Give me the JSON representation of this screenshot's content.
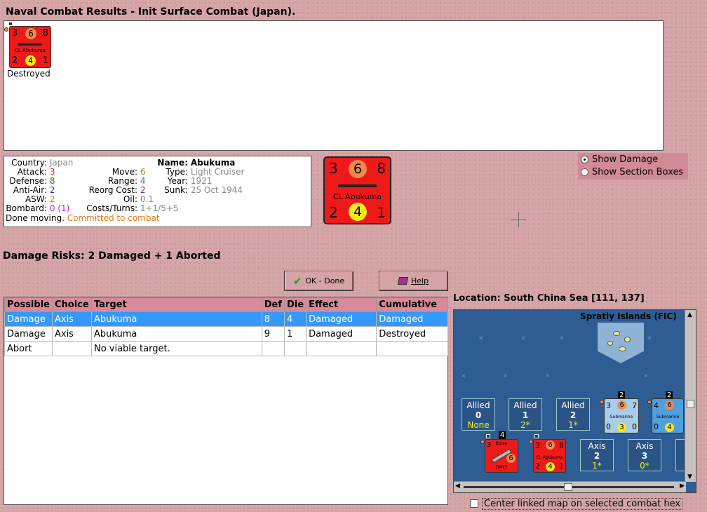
{
  "window": {
    "title": "Naval Combat Results - Init Surface Combat (Japan)."
  },
  "results": {
    "counter": {
      "top_left": "3",
      "top_center": "6",
      "top_right": "8",
      "name": "CL Abukuma",
      "bottom_left": "2",
      "bottom_center": "4",
      "bottom_right": "1"
    },
    "status": "Destroyed"
  },
  "unit_info": {
    "country_label": "Country:",
    "country": "Japan",
    "attack_label": "Attack:",
    "attack": "3",
    "defense_label": "Defense:",
    "defense": "8",
    "antiair_label": "Anti-Air:",
    "antiair": "2",
    "asw_label": "ASW:",
    "asw": "2",
    "bombard_label": "Bombard:",
    "bombard": "0",
    "bombard_extra": "(1)",
    "done_moving": "Done moving.",
    "committed": "Committed to combat",
    "move_label": "Move:",
    "move": "6",
    "range_label": "Range:",
    "range": "4",
    "reorg_label": "Reorg Cost:",
    "reorg": "2",
    "oil_label": "Oil:",
    "oil": "0.1",
    "costs_label": "Costs/Turns:",
    "costs": "1+1/5+5",
    "name_label": "Name:",
    "name": "Abukuma",
    "type_label": "Type:",
    "type": "Light Cruiser",
    "year_label": "Year:",
    "year": "1921",
    "sunk_label": "Sunk:",
    "sunk": "25 Oct 1944"
  },
  "big_counter": {
    "top_left": "3",
    "top_center": "6",
    "top_right": "8",
    "name": "CL Abukuma",
    "bottom_left": "2",
    "bottom_center": "4",
    "bottom_right": "1"
  },
  "view_options": {
    "show_damage": "Show Damage",
    "show_section_boxes": "Show Section Boxes",
    "selected": "show_damage"
  },
  "damage_risks": {
    "label": "Damage Risks:",
    "value": "2 Damaged + 1 Aborted"
  },
  "buttons": {
    "ok": "OK - Done",
    "help": "Help"
  },
  "table": {
    "headers": [
      "Possible",
      "Choice",
      "Target",
      "Def",
      "Die",
      "Effect",
      "Cumulative"
    ],
    "rows": [
      [
        "Damage",
        "Axis",
        "Abukuma",
        "8",
        "4",
        "Damaged",
        "Damaged"
      ],
      [
        "Damage",
        "Axis",
        "Abukuma",
        "9",
        "1",
        "Damaged",
        "Destroyed"
      ],
      [
        "Abort",
        "",
        "No viable target.",
        "",
        "",
        "",
        ""
      ]
    ],
    "selected_row": 0
  },
  "location": {
    "label": "Location:",
    "value": "South China Sea [111, 137]"
  },
  "map": {
    "island_label": "Spratly Islands (FIC)",
    "allied_boxes": [
      {
        "side": "Allied",
        "num": "0",
        "sub": "None"
      },
      {
        "side": "Allied",
        "num": "1",
        "sub": "2*"
      },
      {
        "side": "Allied",
        "num": "2",
        "sub": "1*"
      }
    ],
    "axis_boxes": [
      {
        "side": "Axis",
        "num": "2",
        "sub": "1*"
      },
      {
        "side": "Axis",
        "num": "3",
        "sub": "0*"
      }
    ],
    "sub1": {
      "stack": "2",
      "tl": "3",
      "tc": "6",
      "tr": "7",
      "name": "Submarine",
      "bl": "0",
      "bc": "3",
      "br": "0"
    },
    "sub2": {
      "stack": "2",
      "tl": "4",
      "tc": "6",
      "name": "Submarine",
      "bl": "0",
      "bc": "4"
    },
    "air_unit": {
      "stack": "4",
      "tl": "3",
      "name_top": "Boise",
      "name_bottom": "D4Y3",
      "bc": "6"
    },
    "cl_small": {
      "tl": "3",
      "tc": "6",
      "tr": "8",
      "name": "CL Abukuma",
      "bl": "2",
      "bc": "4",
      "br": "1"
    }
  },
  "center_linked": {
    "label": "Center linked map on selected combat hex",
    "checked": false
  }
}
